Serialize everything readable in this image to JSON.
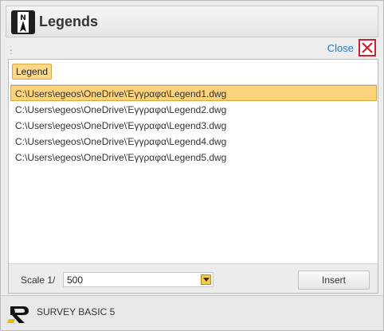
{
  "window": {
    "title": "Legends"
  },
  "toolbar": {
    "close_label": "Close"
  },
  "panel": {
    "legend_button": "Legend",
    "files": [
      {
        "path": "C:\\Users\\egeos\\OneDrive\\Έγγραφα\\Legend1.dwg",
        "selected": true
      },
      {
        "path": "C:\\Users\\egeos\\OneDrive\\Έγγραφα\\Legend2.dwg",
        "selected": false
      },
      {
        "path": "C:\\Users\\egeos\\OneDrive\\Έγγραφα\\Legend3.dwg",
        "selected": false
      },
      {
        "path": "C:\\Users\\egeos\\OneDrive\\Έγγραφα\\Legend4.dwg",
        "selected": false
      },
      {
        "path": "C:\\Users\\egeos\\OneDrive\\Έγγραφα\\Legend5.dwg",
        "selected": false
      }
    ]
  },
  "footer": {
    "scale_label": "Scale 1/",
    "scale_value": "500",
    "insert_label": "Insert"
  },
  "statusbar": {
    "brand": "SURVEY BASIC 5"
  },
  "colors": {
    "selection": "#fcd27a",
    "close_accent": "#d0202a",
    "link": "#1f7ac5"
  }
}
